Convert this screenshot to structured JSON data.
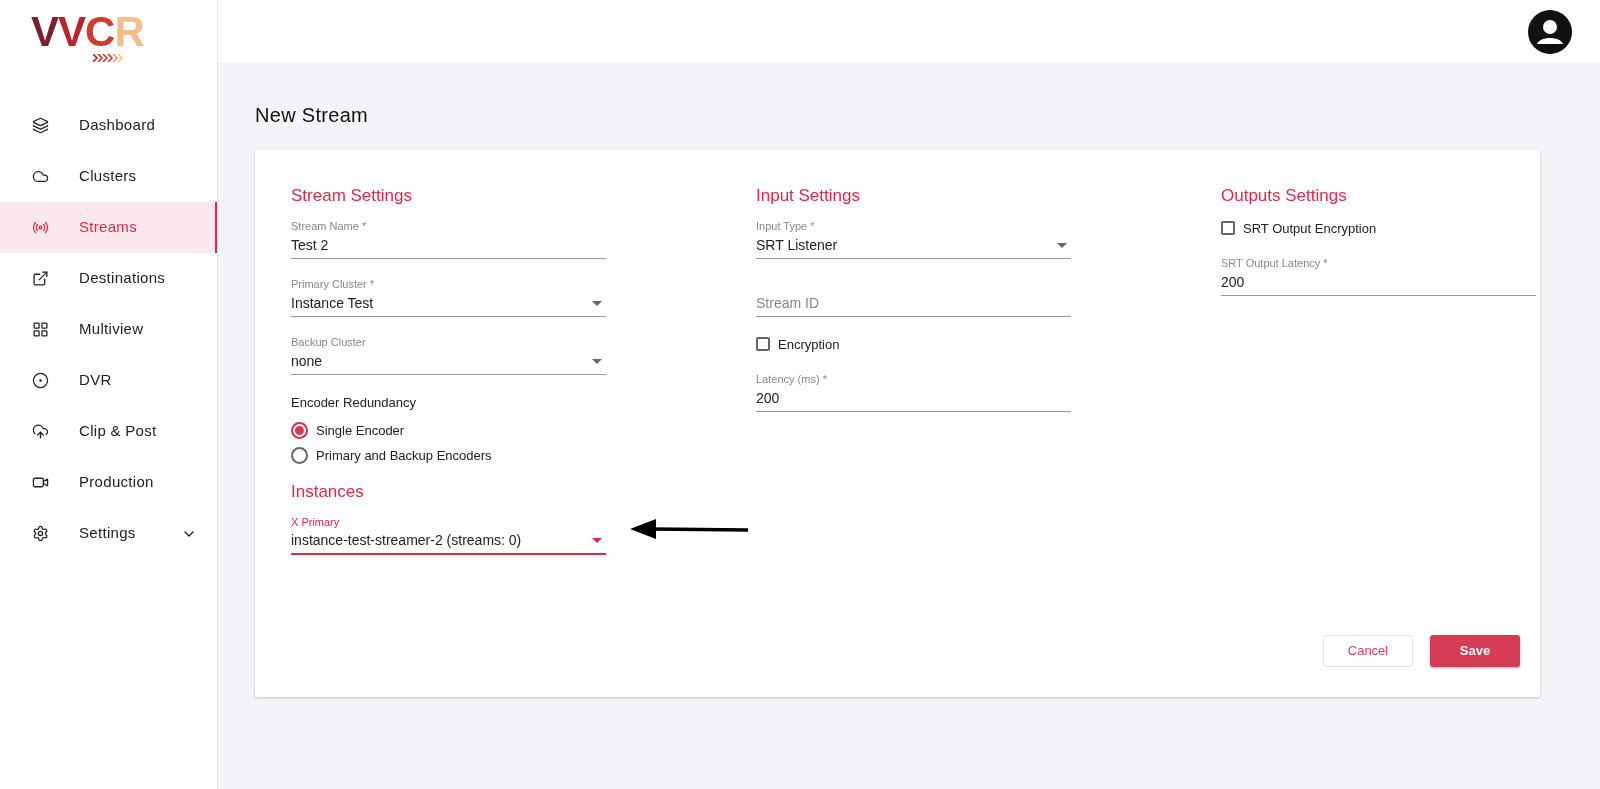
{
  "sidebar": {
    "logo": "VVCR",
    "items": [
      {
        "label": "Dashboard",
        "kind": "link",
        "selected": false
      },
      {
        "label": "Clusters",
        "kind": "link",
        "selected": false
      },
      {
        "label": "Streams",
        "kind": "link",
        "selected": true
      },
      {
        "label": "Destinations",
        "kind": "link",
        "selected": false
      },
      {
        "label": "Multiview",
        "kind": "link",
        "selected": false
      },
      {
        "label": "DVR",
        "kind": "link",
        "selected": false
      },
      {
        "label": "Clip & Post",
        "kind": "link",
        "selected": false
      },
      {
        "label": "Production",
        "kind": "link",
        "selected": false
      },
      {
        "label": "Settings",
        "kind": "group",
        "selected": false,
        "expanded": false
      }
    ]
  },
  "page": {
    "title": "New Stream"
  },
  "columns": [
    {
      "sections": [
        {
          "title": "Stream Settings",
          "fields": [
            {
              "kind": "text",
              "label": "Stream Name *",
              "value": "Test 2",
              "focused": false
            },
            {
              "kind": "select",
              "label": "Primary Cluster *",
              "value": "Instance Test",
              "focused": false
            },
            {
              "kind": "select",
              "label": "Backup Cluster",
              "value": "none",
              "focused": false
            },
            {
              "kind": "radio",
              "label": "Encoder Redundancy",
              "options": [
                {
                  "label": "Single Encoder",
                  "selected": true
                },
                {
                  "label": "Primary and Backup Encoders",
                  "selected": false
                }
              ]
            }
          ]
        },
        {
          "title": "Instances",
          "fields": [
            {
              "kind": "select",
              "label": "X Primary",
              "value": "instance-test-streamer-2 (streams: 0)",
              "focused": true
            }
          ]
        }
      ]
    },
    {
      "sections": [
        {
          "title": "Input Settings",
          "fields": [
            {
              "kind": "select",
              "label": "Input Type *",
              "value": "SRT Listener",
              "focused": false
            },
            {
              "kind": "text",
              "placeholder": "Stream ID",
              "focused": false
            },
            {
              "kind": "checkbox",
              "label": "Encryption",
              "checked": false
            },
            {
              "kind": "text",
              "label": "Latency (ms) *",
              "value": "200",
              "focused": false
            }
          ]
        }
      ]
    },
    {
      "sections": [
        {
          "title": "Outputs Settings",
          "fields": [
            {
              "kind": "checkbox",
              "label": "SRT Output Encryption",
              "checked": false
            },
            {
              "kind": "text",
              "label": "SRT Output Latency *",
              "value": "200",
              "focused": false
            }
          ]
        }
      ]
    }
  ],
  "buttons": [
    {
      "label": "Cancel",
      "kind": "secondary"
    },
    {
      "label": "Save",
      "kind": "primary"
    }
  ]
}
